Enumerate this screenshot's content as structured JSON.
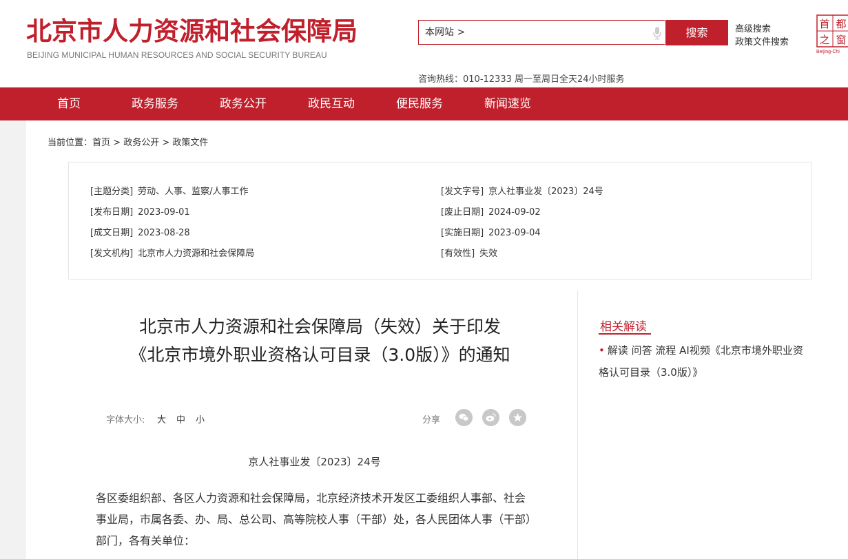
{
  "header": {
    "logo_cn": "北京市人力资源和社会保障局",
    "logo_en": "BEIJING MUNICIPAL HUMAN RESOURCES AND SOCIAL SECURITY BUREAU",
    "search_scope": "本网站 >",
    "search_button": "搜索",
    "advanced_search": "高级搜索",
    "policy_search": "政策文件搜索",
    "emblem_text_tl": "首",
    "emblem_text_tr": "都",
    "emblem_text_bl": "之",
    "emblem_text_br": "窗",
    "emblem_caption": "Beijing-Chi",
    "hotline": "咨询热线：010-12333 周一至周日全天24小时服务"
  },
  "nav": {
    "items": [
      "首页",
      "政务服务",
      "政务公开",
      "政民互动",
      "便民服务",
      "新闻速览"
    ]
  },
  "breadcrumb": {
    "prefix": "当前位置：",
    "items": [
      "首页",
      "政务公开",
      "政策文件"
    ],
    "separator": " > "
  },
  "meta": {
    "left": [
      {
        "key": "[主题分类]",
        "value": "劳动、人事、监察/人事工作"
      },
      {
        "key": "[发布日期]",
        "value": "2023-09-01"
      },
      {
        "key": "[成文日期]",
        "value": "2023-08-28"
      },
      {
        "key": "[发文机构]",
        "value": "北京市人力资源和社会保障局"
      }
    ],
    "right": [
      {
        "key": "[发文字号]",
        "value": "京人社事业发〔2023〕24号"
      },
      {
        "key": "[废止日期]",
        "value": "2024-09-02"
      },
      {
        "key": "[实施日期]",
        "value": "2023-09-04"
      },
      {
        "key": "[有效性]",
        "value": "失效"
      }
    ]
  },
  "article": {
    "title_line1": "北京市人力资源和社会保障局（失效）关于印发",
    "title_line2": "《北京市境外职业资格认可目录（3.0版）》的通知",
    "font_size_label": "字体大小:",
    "font_sizes": [
      "大",
      "中",
      "小"
    ],
    "share_label": "分享",
    "doc_no": "京人社事业发〔2023〕24号",
    "body": "各区委组织部、各区人力资源和社会保障局，北京经济技术开发区工委组织人事部、社会事业局，市属各委、办、局、总公司、高等院校人事（干部）处，各人民团体人事（干部）部门，各有关单位："
  },
  "related": {
    "title": "相关解读",
    "item": "解读 问答 流程 AI视频《北京市境外职业资格认可目录（3.0版）》"
  },
  "colors": {
    "brand_red": "#c0202c"
  }
}
